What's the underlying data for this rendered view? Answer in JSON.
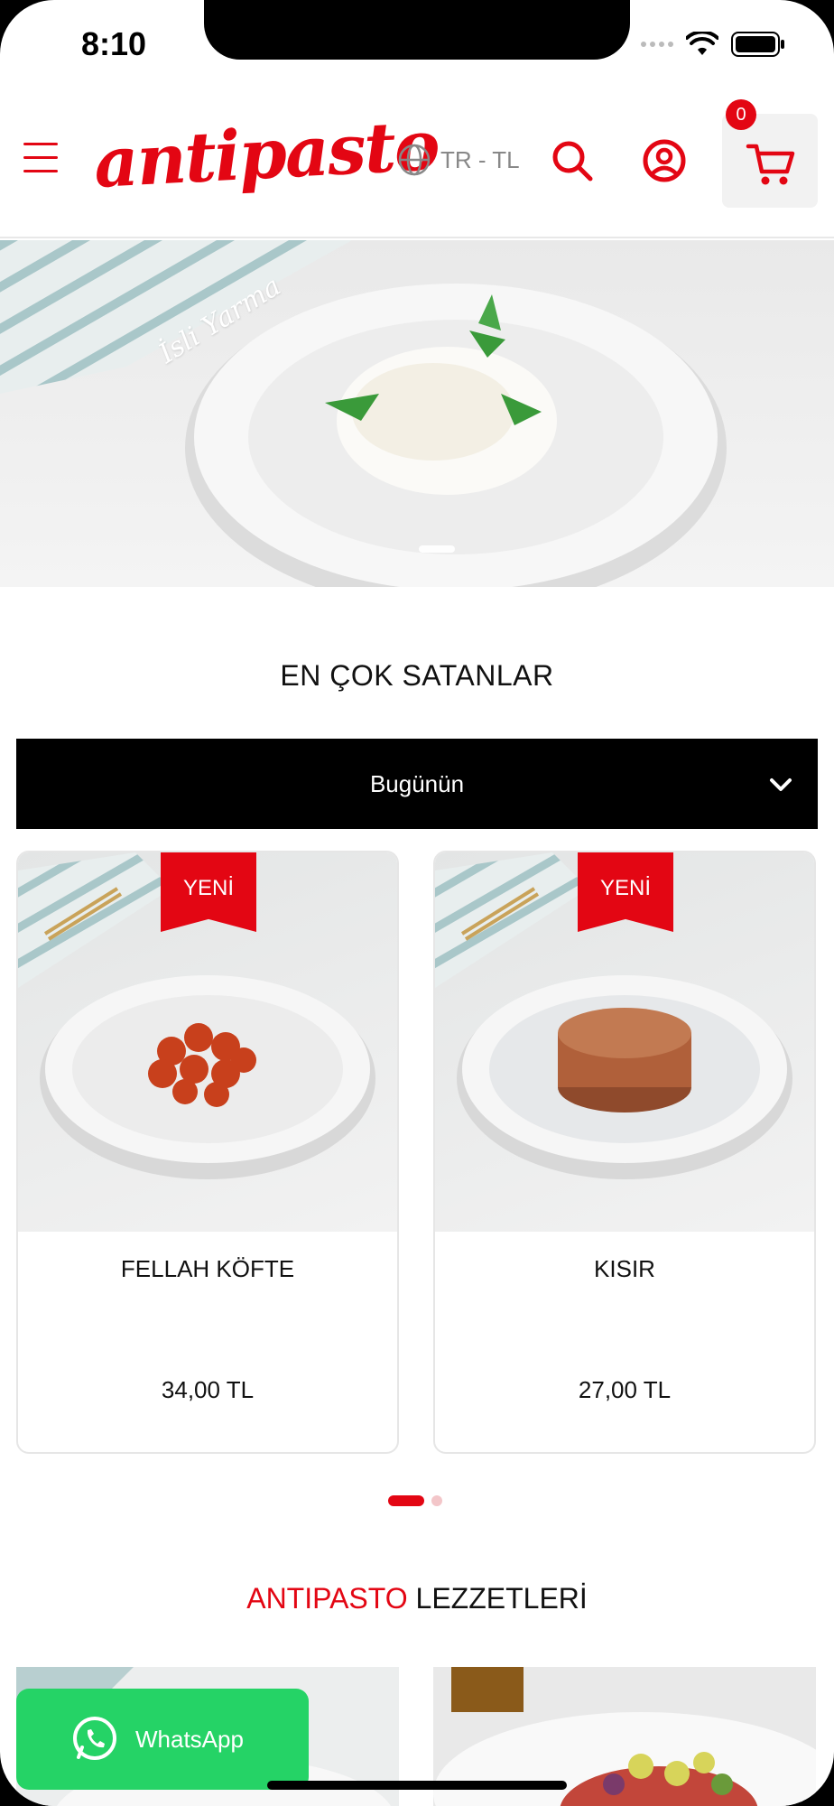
{
  "status": {
    "time": "8:10"
  },
  "header": {
    "logo": "antipasto",
    "lang": "TR - TL",
    "cart_count": "0"
  },
  "hero": {
    "caption": "İsli Yarma"
  },
  "bestsellers": {
    "title": "EN ÇOK SATANLAR",
    "filter": "Bugünün"
  },
  "products": [
    {
      "badge": "YENİ",
      "name": "FELLAH KÖFTE",
      "price": "34,00 TL"
    },
    {
      "badge": "YENİ",
      "name": "KISIR",
      "price": "27,00 TL"
    }
  ],
  "flavors": {
    "title_red": "ANTIPASTO",
    "title_rest": " LEZZETLERİ"
  },
  "whatsapp": {
    "label": "WhatsApp"
  },
  "colors": {
    "brand": "#e30613",
    "whatsapp": "#25d366"
  }
}
